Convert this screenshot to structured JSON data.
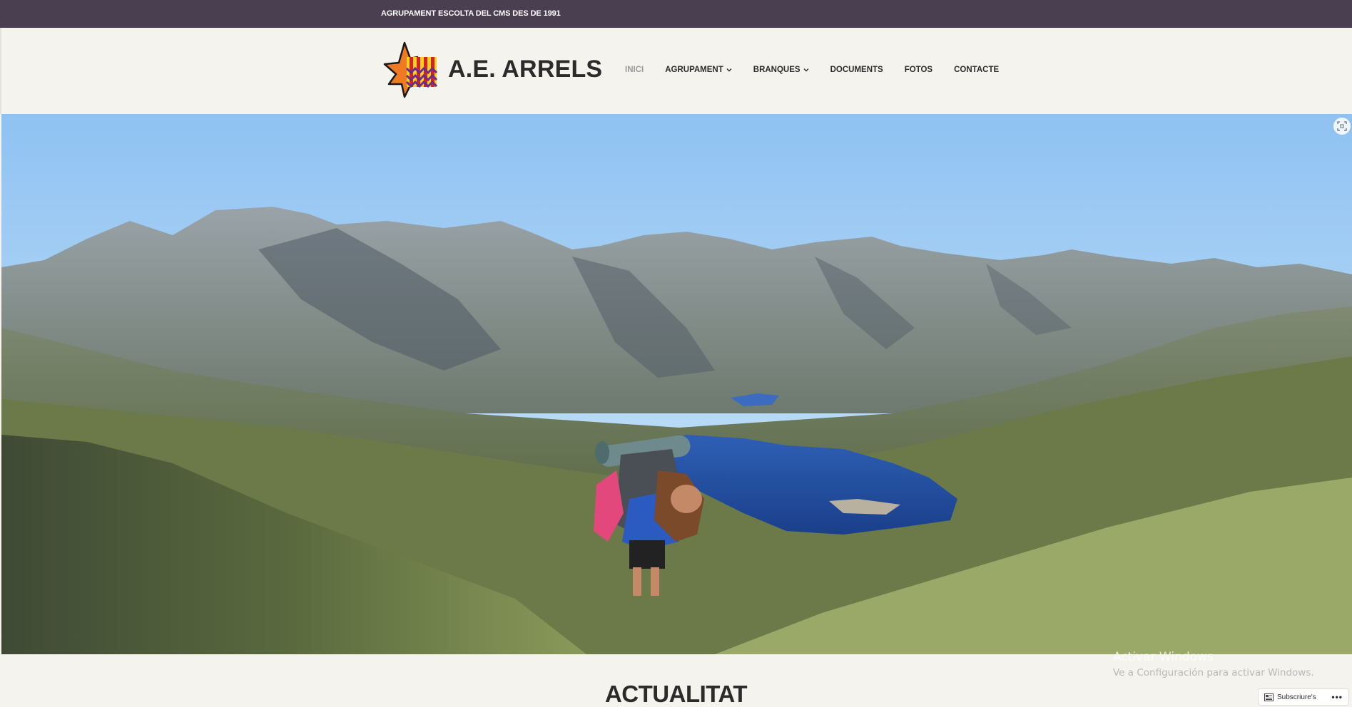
{
  "topbar": {
    "tagline": "AGRUPAMENT ESCOLTA DEL CMS DES DE 1991"
  },
  "header": {
    "site_title": "A.E. ARRELS",
    "logo_icon": "arrels-star-flag-logo"
  },
  "nav": {
    "items": [
      {
        "label": "INICI",
        "active": true,
        "has_dropdown": false
      },
      {
        "label": "AGRUPAMENT",
        "active": false,
        "has_dropdown": true
      },
      {
        "label": "BRANQUES",
        "active": false,
        "has_dropdown": true
      },
      {
        "label": "DOCUMENTS",
        "active": false,
        "has_dropdown": false
      },
      {
        "label": "FOTOS",
        "active": false,
        "has_dropdown": false
      },
      {
        "label": "CONTACTE",
        "active": false,
        "has_dropdown": false
      }
    ]
  },
  "hero": {
    "expand_icon": "fullscreen-icon"
  },
  "main": {
    "section_title": "ACTUALITAT"
  },
  "watermark": {
    "line1": "Activar Windows",
    "line2": "Ve a Configuración para activar Windows."
  },
  "subscribe_bar": {
    "subscribe_label": "Subscriure's",
    "more_label": "•••",
    "icon": "reader-icon"
  },
  "colors": {
    "topbar": "#4a3f50",
    "header_bg": "#f4f3ee",
    "logo_orange": "#f07a22",
    "logo_red": "#d2232a",
    "logo_yellow": "#f7d21a",
    "logo_purple": "#6a2c8e"
  }
}
